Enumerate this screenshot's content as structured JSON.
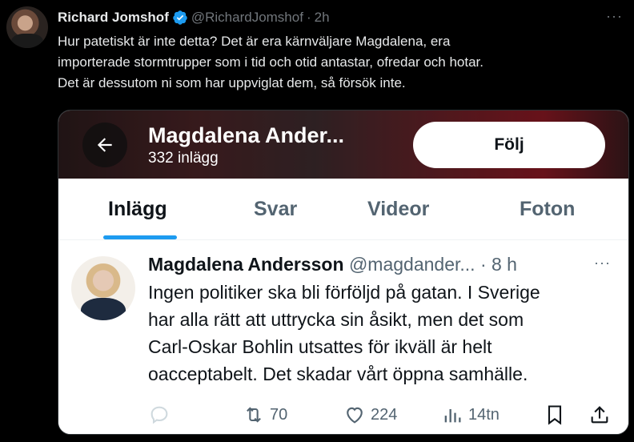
{
  "tweet": {
    "author_name": "Richard Jomshof",
    "handle": "@RichardJomshof",
    "separator": "·",
    "time": "2h",
    "more": "···",
    "text_lines": [
      "Hur patetiskt är inte detta? Det är era kärnväljare Magdalena, era",
      "importerade stormtrupper som i tid och otid antastar, ofredar och hotar.",
      "Det är dessutom ni som har uppviglat dem, så försök inte."
    ]
  },
  "embedded": {
    "profile_name": "Magdalena Ander...",
    "post_count": "332 inlägg",
    "follow_label": "Följ",
    "tabs": [
      "Inlägg",
      "Svar",
      "Videor",
      "Foton"
    ],
    "active_tab": "Inlägg",
    "post": {
      "author": "Magdalena Andersson",
      "handle": "@magdander...",
      "separator": "·",
      "time": "8 h",
      "more": "···",
      "text_lines": [
        "Ingen politiker ska bli förföljd på gatan. I Sverige",
        "har alla rätt att uttrycka sin åsikt, men det som",
        "Carl-Oskar Bohlin utsattes för ikväll är helt",
        "oacceptabelt. Det skadar vårt öppna samhälle."
      ],
      "actions": {
        "reply_icon": "reply-icon",
        "retweets": "70",
        "likes": "224",
        "views": "14tn",
        "bookmark_icon": "bookmark-icon",
        "share_icon": "share-icon"
      }
    }
  },
  "colors": {
    "accent": "#1d9bf0",
    "text_dark": "#0f1419",
    "text_muted": "#536471",
    "background": "#000000"
  }
}
